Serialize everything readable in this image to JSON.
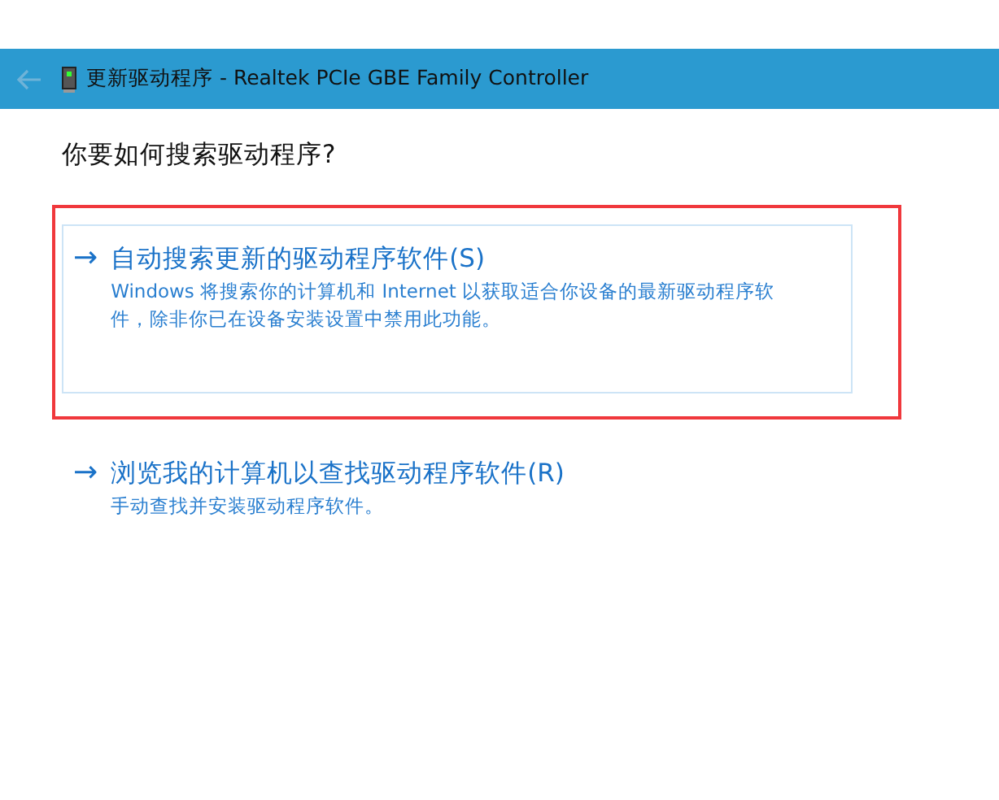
{
  "window": {
    "title": "更新驱动程序 - Realtek PCIe GBE Family Controller"
  },
  "heading": "你要如何搜索驱动程序?",
  "options": [
    {
      "arrow": "→",
      "title": "自动搜索更新的驱动程序软件(S)",
      "description": "Windows 将搜索你的计算机和 Internet 以获取适合你设备的最新驱动程序软件，除非你已在设备安装设置中禁用此功能。",
      "selected": true,
      "highlighted": true
    },
    {
      "arrow": "→",
      "title": "浏览我的计算机以查找驱动程序软件(R)",
      "description": "手动查找并安装驱动程序软件。",
      "selected": false,
      "highlighted": false
    }
  ]
}
